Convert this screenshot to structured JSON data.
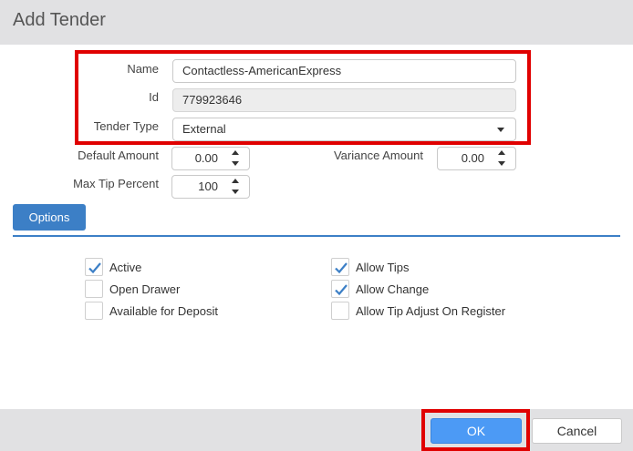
{
  "dialog": {
    "title": "Add Tender"
  },
  "fields": {
    "name": {
      "label": "Name",
      "value": "Contactless-AmericanExpress"
    },
    "id": {
      "label": "Id",
      "value": "779923646"
    },
    "tender_type": {
      "label": "Tender Type",
      "value": "External"
    },
    "default_amount": {
      "label": "Default Amount",
      "value": "0.00"
    },
    "variance_amount": {
      "label": "Variance Amount",
      "value": "0.00"
    },
    "max_tip_percent": {
      "label": "Max Tip Percent",
      "value": "100"
    }
  },
  "tabs": {
    "options": "Options"
  },
  "checkboxes": {
    "active": {
      "label": "Active",
      "checked": true
    },
    "open_drawer": {
      "label": "Open Drawer",
      "checked": false
    },
    "available_for_deposit": {
      "label": "Available for Deposit",
      "checked": false
    },
    "allow_tips": {
      "label": "Allow Tips",
      "checked": true
    },
    "allow_change": {
      "label": "Allow Change",
      "checked": true
    },
    "allow_tip_adjust": {
      "label": "Allow Tip Adjust On Register",
      "checked": false
    }
  },
  "footer": {
    "ok": "OK",
    "cancel": "Cancel"
  },
  "colors": {
    "accent": "#3c7fc6",
    "highlight": "#e00000",
    "ok_button": "#4c9af5",
    "header_bg": "#e1e1e3"
  }
}
